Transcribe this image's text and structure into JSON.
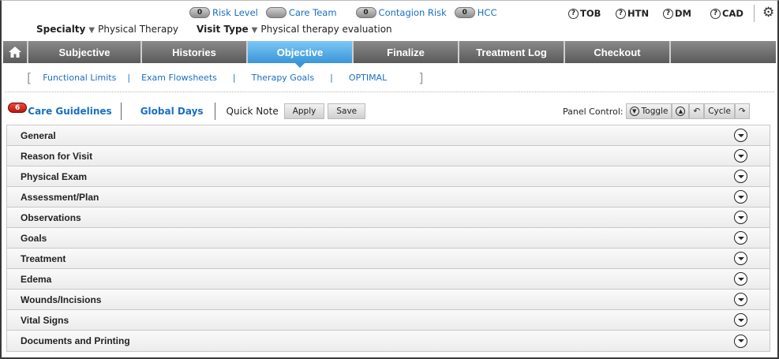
{
  "top": {
    "badges": [
      {
        "count": "0",
        "label": "Risk Level"
      },
      {
        "count": "",
        "label": "Care Team"
      },
      {
        "count": "0",
        "label": "Contagion Risk"
      },
      {
        "count": "0",
        "label": "HCC"
      }
    ],
    "help": [
      "TOB",
      "HTN",
      "DM",
      "CAD"
    ],
    "help_glyph": "?",
    "specialty_label": "Specialty",
    "specialty_value": "Physical Therapy",
    "visit_type_label": "Visit Type",
    "visit_type_value": "Physical therapy evaluation",
    "gear_icon": "gear-icon",
    "accent_color": "#3a95d8",
    "link_color": "#1a6fc2"
  },
  "nav": {
    "tabs": [
      "Subjective",
      "Histories",
      "Objective",
      "Finalize",
      "Treatment Log",
      "Checkout"
    ],
    "active": "Objective"
  },
  "subnav": {
    "items": [
      "Functional Limits",
      "Exam Flowsheets",
      "Therapy Goals",
      "OPTIMAL"
    ],
    "separator": "|"
  },
  "toolbar": {
    "alert_count": "6",
    "care_guidelines": "Care Guidelines",
    "global_days": "Global Days",
    "quick_note": "Quick Note",
    "apply": "Apply",
    "save": "Save",
    "panel_control_label": "Panel Control:",
    "toggle": "Toggle",
    "cycle": "Cycle"
  },
  "sections": [
    "General",
    "Reason for Visit",
    "Physical Exam",
    "Assessment/Plan",
    "Observations",
    "Goals",
    "Treatment",
    "Edema",
    "Wounds/Incisions",
    "Vital Signs",
    "Documents and Printing"
  ]
}
